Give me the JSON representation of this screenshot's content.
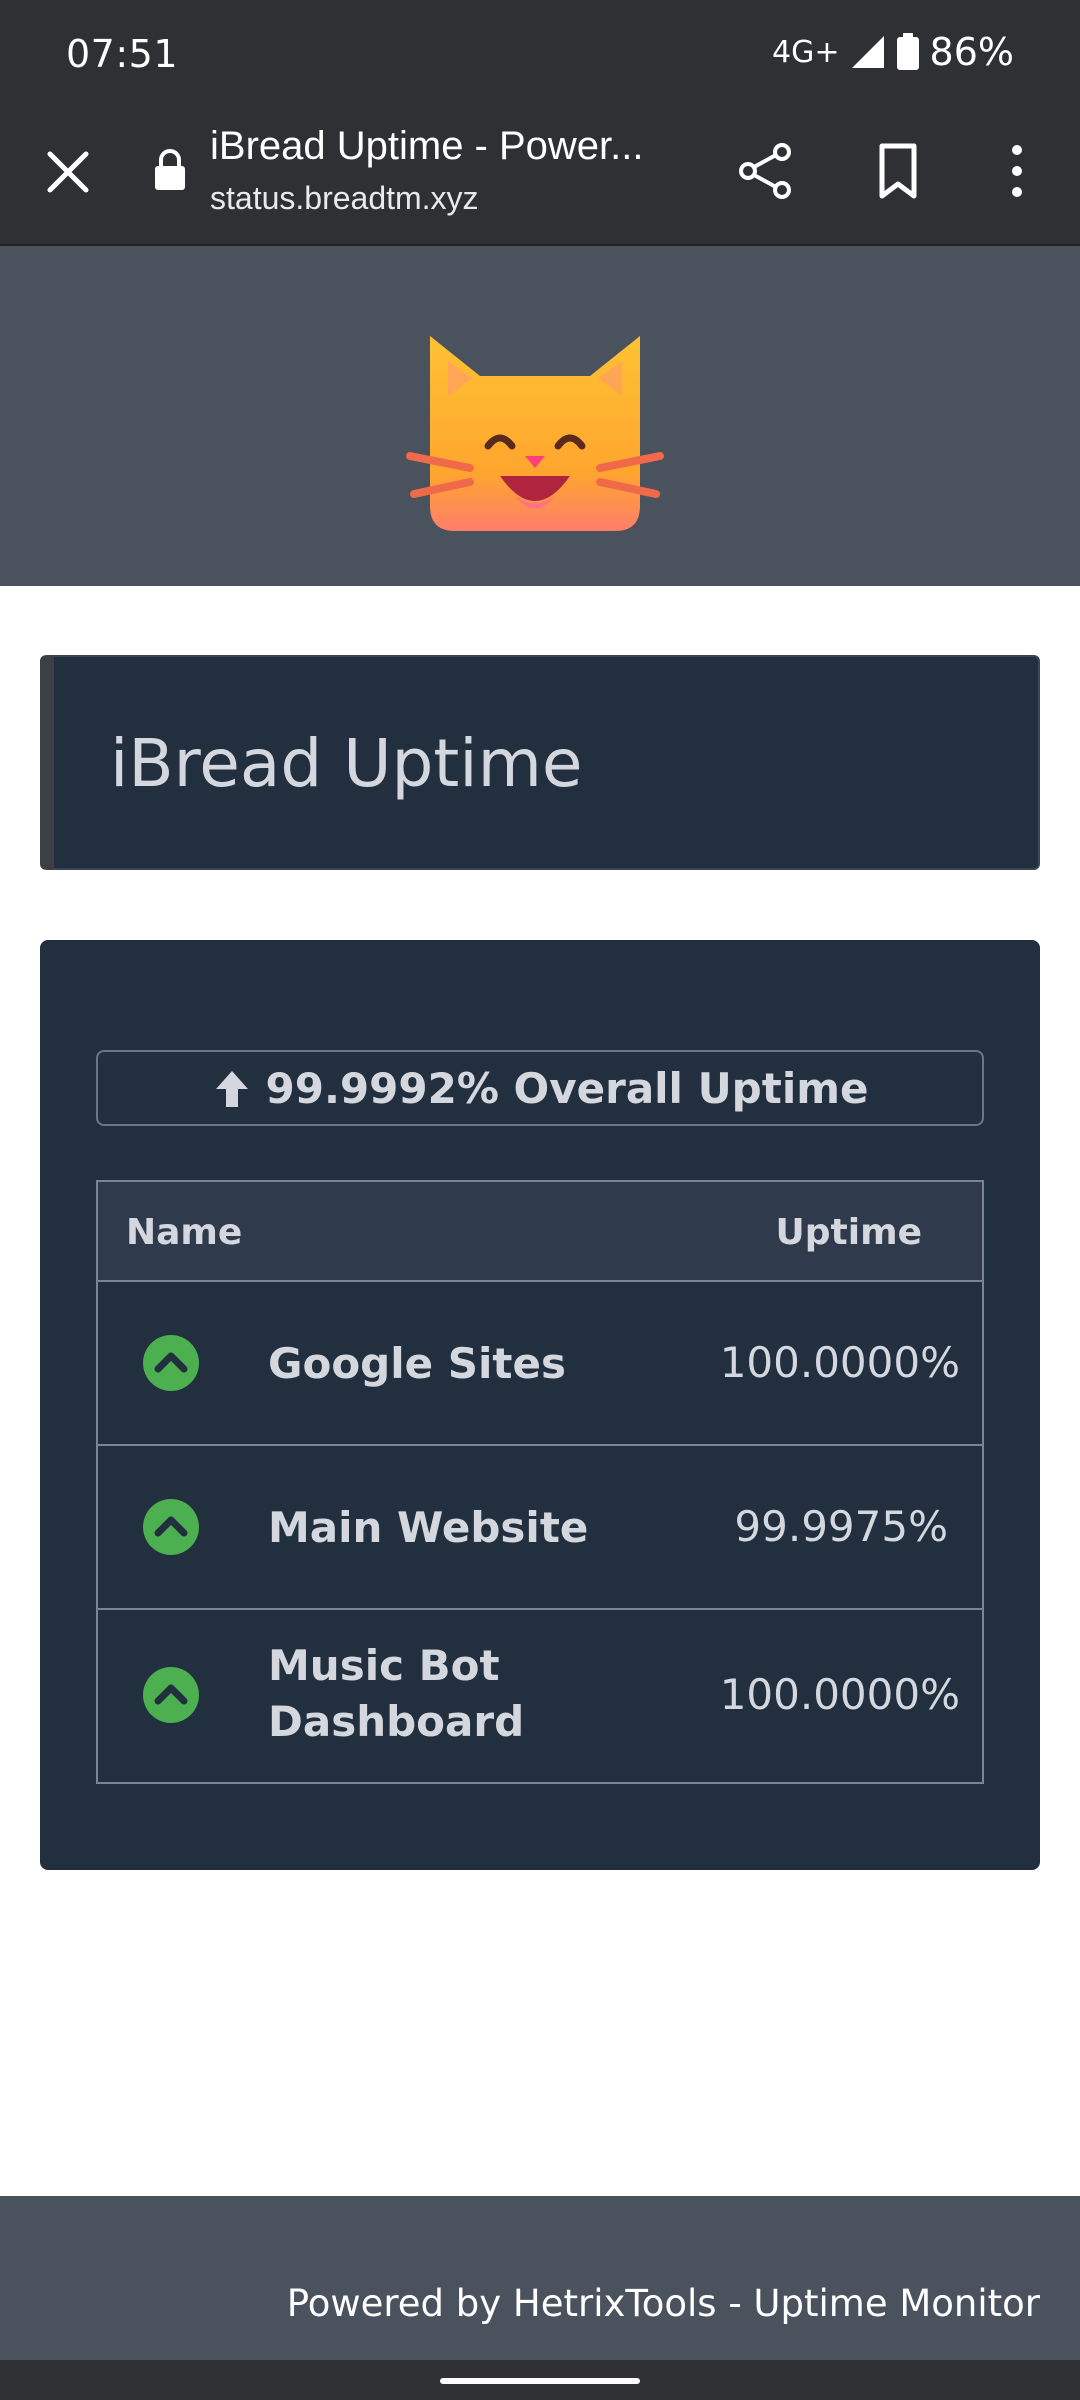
{
  "status_bar": {
    "time": "07:51",
    "network": "4G+",
    "battery": "86%"
  },
  "browser": {
    "page_title": "iBread Uptime - Power...",
    "url": "status.breadtm.xyz",
    "icons": [
      "close-icon",
      "lock-icon",
      "share-icon",
      "bookmark-icon",
      "more-vert-icon"
    ]
  },
  "header": {
    "logo": "smiling-cat-emoji"
  },
  "title_card": {
    "title": "iBread Uptime"
  },
  "overall": {
    "label": "99.9992% Overall Uptime",
    "icon": "arrow-up-icon"
  },
  "table": {
    "headers": {
      "name": "Name",
      "uptime": "Uptime"
    },
    "rows": [
      {
        "name": "Google Sites",
        "uptime": "100.0000%",
        "status": "up"
      },
      {
        "name": "Main Website",
        "uptime": "99.9975%",
        "status": "up"
      },
      {
        "name": "Music Bot Dashboard",
        "uptime": "100.0000%",
        "status": "up"
      }
    ]
  },
  "colors": {
    "status_up": "#4caf50",
    "panel_bg": "#222f3e",
    "header_bg": "#4a525e"
  },
  "footer": {
    "text": "Powered by HetrixTools - Uptime Monitor"
  }
}
